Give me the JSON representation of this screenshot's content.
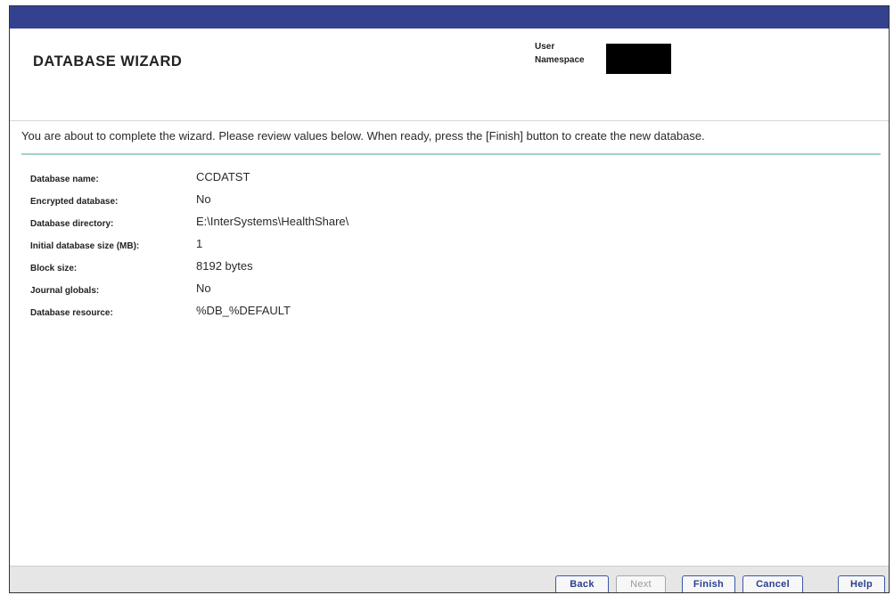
{
  "header": {
    "title": "DATABASE WIZARD",
    "user_label": "User",
    "namespace_label": "Namespace"
  },
  "intro_text": "You are about to complete the wizard. Please review values below. When ready, press the [Finish] button to create the new database.",
  "review": [
    {
      "label": "Database name:",
      "value": "CCDATST"
    },
    {
      "label": "Encrypted database:",
      "value": "No"
    },
    {
      "label": "Database directory:",
      "value": "E:\\InterSystems\\HealthShare\\"
    },
    {
      "label": "Initial database size (MB):",
      "value": "1"
    },
    {
      "label": "Block size:",
      "value": "8192 bytes"
    },
    {
      "label": "Journal globals:",
      "value": "No"
    },
    {
      "label": "Database resource:",
      "value": "%DB_%DEFAULT"
    }
  ],
  "buttons": {
    "back": "Back",
    "next": "Next",
    "finish": "Finish",
    "cancel": "Cancel",
    "help": "Help"
  },
  "colors": {
    "topbar": "#34418f",
    "accent_line": "#9fd3cc",
    "button_border": "#3d56a8"
  }
}
